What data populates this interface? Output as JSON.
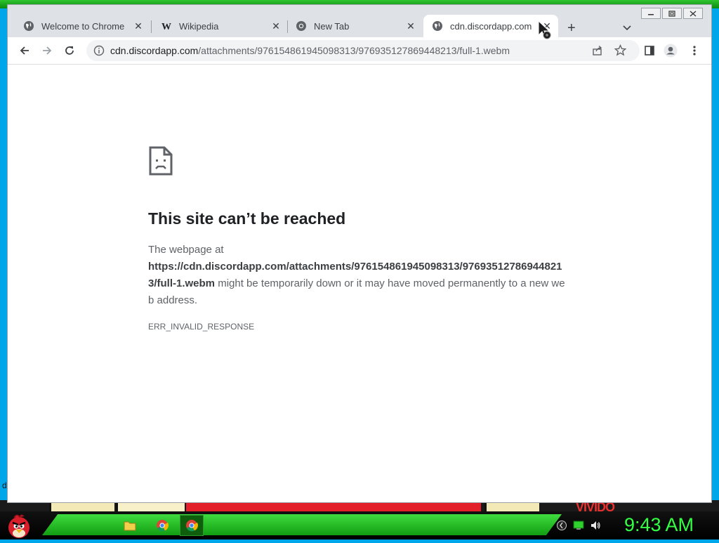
{
  "browser": {
    "tabs": [
      {
        "title": "Welcome to Chrome",
        "icon": "globe-icon",
        "active": false
      },
      {
        "title": "Wikipedia",
        "icon": "wikipedia-icon",
        "active": false
      },
      {
        "title": "New Tab",
        "icon": "chrome-icon",
        "active": false
      },
      {
        "title": "cdn.discordapp.com",
        "icon": "globe-icon",
        "active": true
      }
    ],
    "close_glyph": "✕",
    "new_tab_glyph": "+",
    "address": {
      "host": "cdn.discordapp.com",
      "path": "/attachments/976154861945098313/976935127869448213/full-1.webm"
    }
  },
  "error_page": {
    "title": "This site can’t be reached",
    "desc_prefix": "The webpage at",
    "url": "https://cdn.discordapp.com/attachments/976154861945098313/976935127869448213/full-1.webm",
    "desc_suffix": "might be temporarily down or it may have moved permanently to a new web address.",
    "error_code": "ERR_INVALID_RESPONSE"
  },
  "taskbar": {
    "clock": "9:43 AM",
    "items": [
      "file-manager-icon",
      "chrome-icon",
      "chrome-icon"
    ]
  },
  "desktop": {
    "stray_text": "d",
    "art_text": "VIVIDO"
  }
}
